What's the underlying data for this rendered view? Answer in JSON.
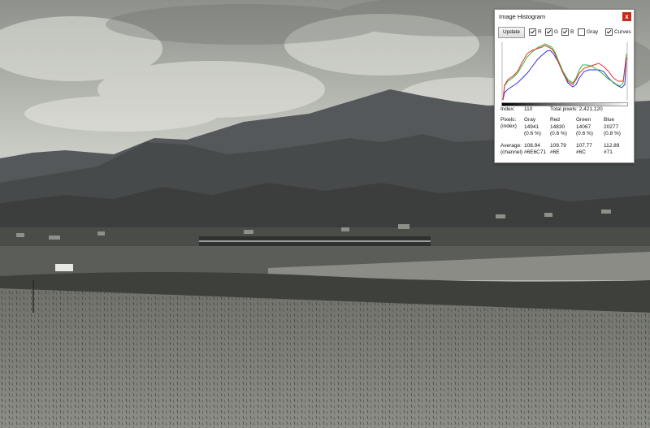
{
  "window": {
    "title": "Image Histogram",
    "close_label": "x",
    "close_icon": "close-icon"
  },
  "toolbar": {
    "update_label": "Update",
    "checkboxes": [
      {
        "label": "R",
        "checked": true
      },
      {
        "label": "G",
        "checked": true
      },
      {
        "label": "B",
        "checked": true
      },
      {
        "label": "Gray",
        "checked": false
      },
      {
        "label": "Curves",
        "checked": true
      }
    ]
  },
  "stats": {
    "index_label": "Index:",
    "index_value": "110",
    "total_label": "Total pixels: 2,421,120",
    "pixels_label": "Pixels:",
    "pixels_sub": "(index)",
    "average_label": "Average:",
    "average_sub": "(channel)",
    "channels": [
      {
        "name": "Gray",
        "count": "14941",
        "pct": "(0.6 %)",
        "avg": "108.94",
        "hex": "#6E6C71"
      },
      {
        "name": "Red",
        "count": "14830",
        "pct": "(0.6 %)",
        "avg": "109.79",
        "hex": "#6E"
      },
      {
        "name": "Green",
        "count": "14067",
        "pct": "(0.6 %)",
        "avg": "107.77",
        "hex": "#6C"
      },
      {
        "name": "Blue",
        "count": "20277",
        "pct": "(0.8 %)",
        "avg": "112.89",
        "hex": "#71"
      }
    ]
  },
  "colors": {
    "red": "#e03030",
    "green": "#2fb82f",
    "blue": "#3030e0",
    "close": "#c42b1c"
  }
}
